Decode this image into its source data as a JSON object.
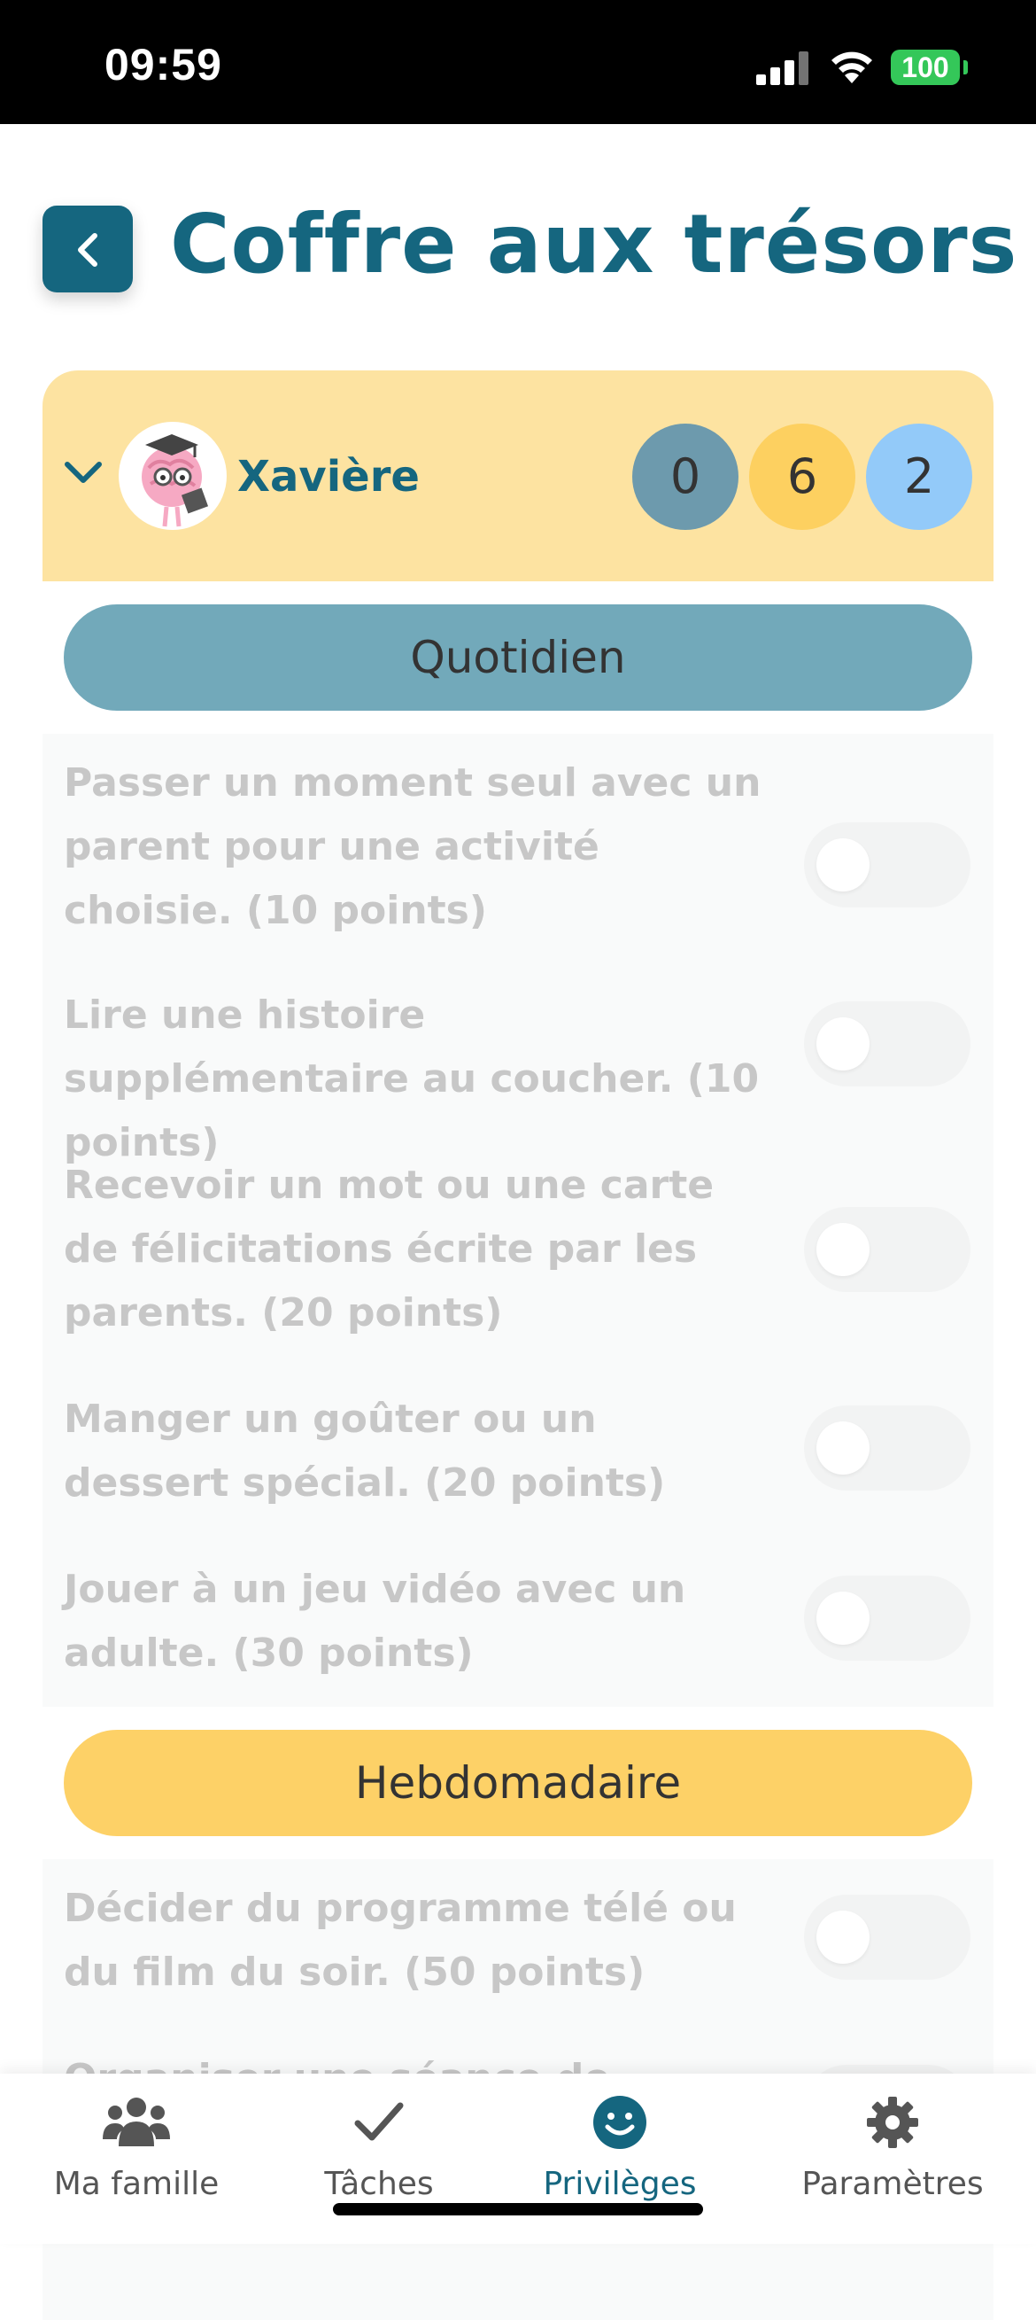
{
  "status_bar": {
    "time": "09:59",
    "battery": "100",
    "icons": [
      "signal-icon",
      "wifi-icon",
      "battery-icon"
    ]
  },
  "header": {
    "back_icon": "chevron-left-icon",
    "title": "Coffre aux trésors"
  },
  "child": {
    "name": "Xavière",
    "avatar_icon": "brain-graduate-avatar",
    "counters": [
      "0",
      "6",
      "2"
    ]
  },
  "sections": [
    {
      "label": "Quotidien",
      "rewards": [
        {
          "text": "Passer un moment seul avec un parent pour une activité choisie. (10 points)",
          "enabled": false
        },
        {
          "text": "Lire une histoire supplémentaire au coucher. (10 points)",
          "enabled": false
        },
        {
          "text": "Recevoir un mot ou une carte de félicitations écrite par les parents. (20 points)",
          "enabled": false
        },
        {
          "text": "Manger un goûter ou un dessert spécial. (20 points)",
          "enabled": false
        },
        {
          "text": "Jouer à un jeu vidéo avec un adulte. (30 points)",
          "enabled": false
        }
      ]
    },
    {
      "label": "Hebdomadaire",
      "rewards": [
        {
          "text": "Décider du programme télé ou du film du soir. (50 points)",
          "enabled": false
        },
        {
          "text": "Organiser une séance de maquillage",
          "enabled": false
        }
      ]
    }
  ],
  "colors": {
    "brand": "#15667f",
    "header_bg": "#fde3a1",
    "counter_gray": "#6d9aad",
    "counter_yellow": "#fdd060",
    "counter_blue": "#93caf9",
    "pill_daily": "#72a9ba",
    "pill_weekly": "#fdd167"
  },
  "tabs": [
    {
      "label": "Ma famille",
      "icon": "users-icon",
      "active": false
    },
    {
      "label": "Tâches",
      "icon": "checkmark-icon",
      "active": false
    },
    {
      "label": "Privilèges",
      "icon": "smiley-icon",
      "active": true
    },
    {
      "label": "Paramètres",
      "icon": "gear-icon",
      "active": false
    }
  ]
}
